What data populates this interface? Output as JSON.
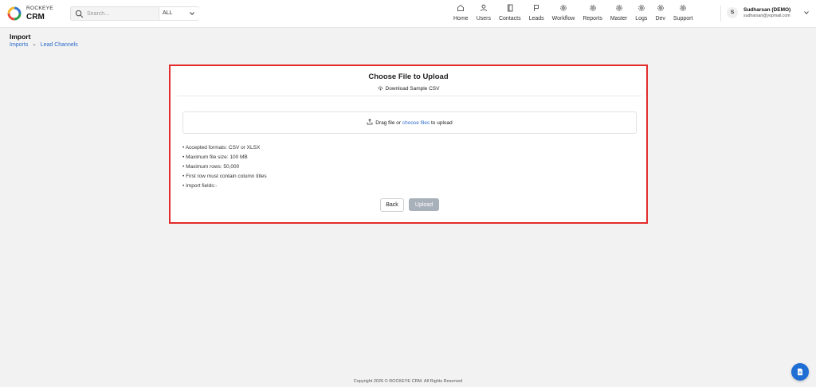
{
  "brand": {
    "line1": "ROCKEYE",
    "line2": "CRM",
    "logo_icon": "crm-logo-ring"
  },
  "search": {
    "placeholder": "Search...",
    "icon": "search-icon",
    "scope_value": "ALL"
  },
  "nav": [
    {
      "label": "Home",
      "icon": "home-icon"
    },
    {
      "label": "Users",
      "icon": "user-icon"
    },
    {
      "label": "Contacts",
      "icon": "contacts-book-icon"
    },
    {
      "label": "Leads",
      "icon": "flag-icon"
    },
    {
      "label": "Workflow",
      "icon": "gear-icon"
    },
    {
      "label": "Reports",
      "icon": "gear-icon"
    },
    {
      "label": "Master",
      "icon": "gear-icon"
    },
    {
      "label": "Logs",
      "icon": "gear-icon"
    },
    {
      "label": "Dev",
      "icon": "gear-icon"
    },
    {
      "label": "Support",
      "icon": "gear-icon"
    }
  ],
  "user": {
    "initial": "S",
    "name": "Sudharsan (DEMO)",
    "email": "sudharsan@yopmail.com"
  },
  "page": {
    "title": "Import",
    "breadcrumb": [
      "Imports",
      "Lead Channels"
    ],
    "breadcrumb_separator": "»"
  },
  "upload": {
    "title": "Choose File to Upload",
    "download_label": "Download Sample CSV",
    "drop_text_before": "Drag file or ",
    "drop_link": "choose files",
    "drop_text_after": " to upload",
    "rules": [
      "• Accepted formats: CSV or XLSX",
      "• Maximum file size: 100 MB",
      "• Maximum rows: 50,000",
      "• First row must contain column titles",
      "• Import fields:-"
    ],
    "back_label": "Back",
    "upload_label": "Upload"
  },
  "footer": {
    "text": "Copyright 2026 © ROCKEYE CRM. All Rights Reserved"
  },
  "fab": {
    "icon": "document-icon"
  },
  "colors": {
    "accent": "#1f6ed4",
    "link": "#2b6bc9",
    "highlight_border": "#e32b2b",
    "upload_disabled": "#a8b0ba"
  }
}
